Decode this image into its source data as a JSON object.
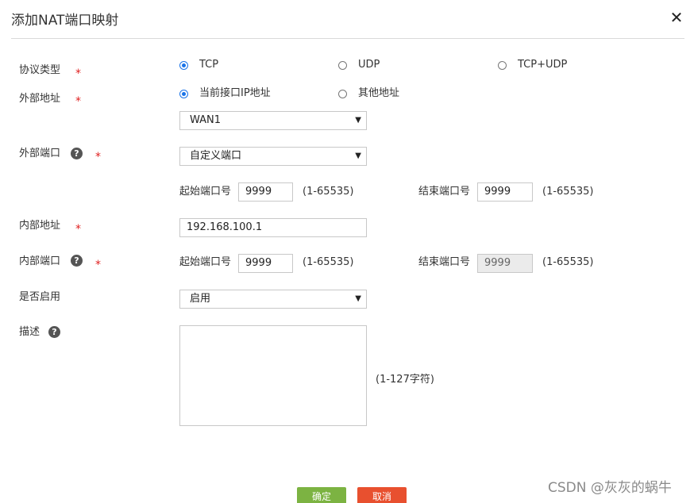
{
  "dialog": {
    "title": "添加NAT端口映射",
    "close_icon": "close-icon"
  },
  "protocol": {
    "label": "协议类型",
    "required": "*",
    "options": [
      {
        "label": "TCP",
        "checked": true
      },
      {
        "label": "UDP",
        "checked": false
      },
      {
        "label": "TCP+UDP",
        "checked": false
      }
    ]
  },
  "external_address": {
    "label": "外部地址",
    "required": "*",
    "options": [
      {
        "label": "当前接口IP地址",
        "checked": true
      },
      {
        "label": "其他地址",
        "checked": false
      }
    ],
    "interface_value": "WAN1"
  },
  "external_port": {
    "label": "外部端口",
    "help": "?",
    "required": "*",
    "mode_value": "自定义端口",
    "start_label": "起始端口号",
    "start_value": "9999",
    "start_range": "(1-65535)",
    "end_label": "结束端口号",
    "end_value": "9999",
    "end_range": "(1-65535)"
  },
  "internal_address": {
    "label": "内部地址",
    "required": "*",
    "value": "192.168.100.1"
  },
  "internal_port": {
    "label": "内部端口",
    "help": "?",
    "required": "*",
    "start_label": "起始端口号",
    "start_value": "9999",
    "start_range": "(1-65535)",
    "end_label": "结束端口号",
    "end_value": "9999",
    "end_range": "(1-65535)"
  },
  "enabled": {
    "label": "是否启用",
    "value": "启用"
  },
  "description": {
    "label": "描述",
    "help": "?",
    "value": "",
    "limit": "(1-127字符)"
  },
  "buttons": {
    "ok_label": "确定",
    "cancel_label": "取消"
  },
  "watermark": "CSDN @灰灰的蜗牛",
  "colors": {
    "accent": "#1a73e8",
    "required": "#e02020",
    "ok": "#7cb342",
    "cancel": "#e8502f"
  }
}
